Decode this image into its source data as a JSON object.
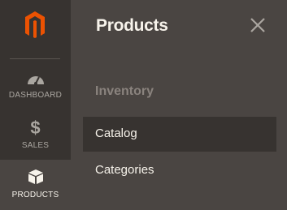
{
  "sidebar": {
    "logo_icon": "magento-logo-icon",
    "items": [
      {
        "label": "DASHBOARD",
        "icon": "dashboard-gauge-icon"
      },
      {
        "label": "SALES",
        "icon": "dollar-icon",
        "glyph": "$"
      },
      {
        "label": "PRODUCTS",
        "icon": "box-icon",
        "active": true
      }
    ]
  },
  "panel": {
    "title": "Products",
    "close_icon": "close-icon",
    "section": "Inventory",
    "items": [
      {
        "label": "Catalog",
        "active": true
      },
      {
        "label": "Categories"
      }
    ]
  },
  "colors": {
    "sidebar_bg": "#373330",
    "panel_bg": "#4a4542",
    "accent": "#eb5202",
    "text_light": "#f7f3eb",
    "text_muted": "#8a837e"
  }
}
